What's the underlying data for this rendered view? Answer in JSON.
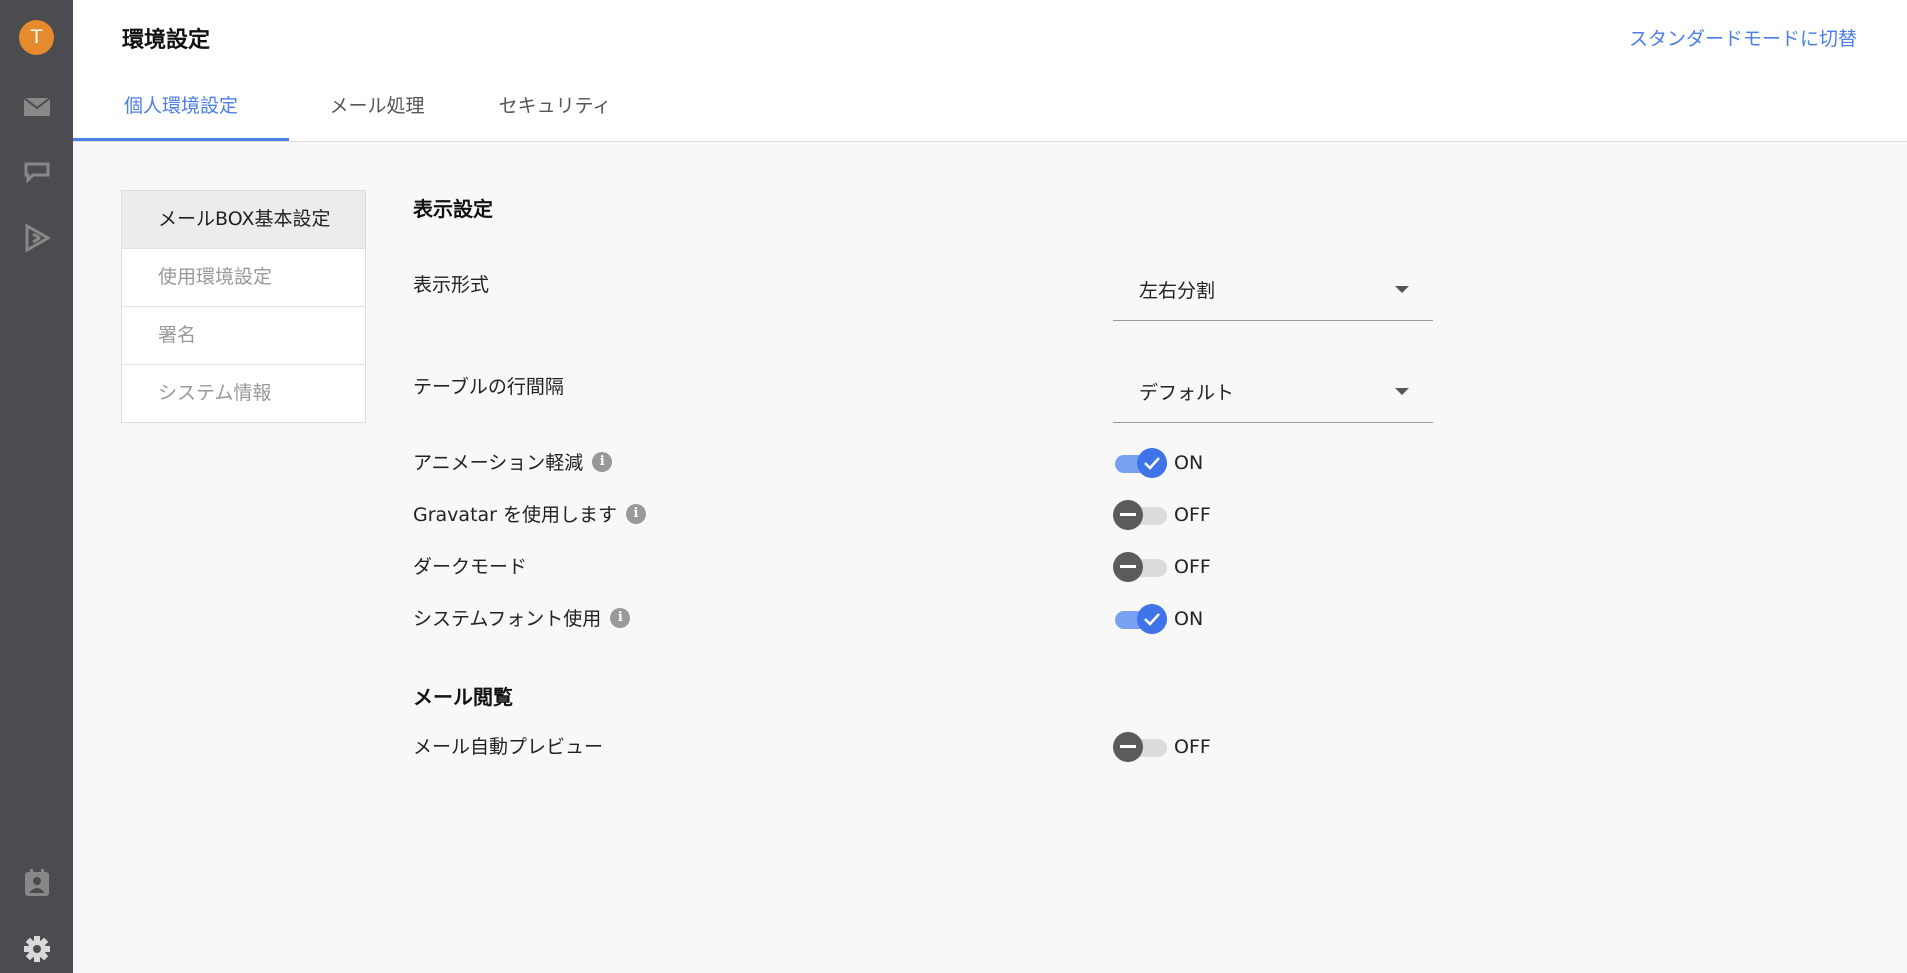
{
  "rail": {
    "avatar_letter": "T",
    "icons": [
      "mail-icon",
      "chat-icon",
      "send-icon",
      "contacts-icon",
      "gear-icon"
    ]
  },
  "header": {
    "title": "環境設定",
    "mode_link": "スタンダードモードに切替",
    "tabs": [
      {
        "label": "個人環境設定",
        "active": true
      },
      {
        "label": "メール処理",
        "active": false
      },
      {
        "label": "セキュリティ",
        "active": false
      }
    ],
    "accent_color": "#4a7fe8"
  },
  "subnav": {
    "items": [
      {
        "label": "メールBOX基本設定",
        "selected": true
      },
      {
        "label": "使用環境設定",
        "selected": false
      },
      {
        "label": "署名",
        "selected": false
      },
      {
        "label": "システム情報",
        "selected": false
      }
    ]
  },
  "display_settings": {
    "title": "表示設定",
    "display_format": {
      "label": "表示形式",
      "value": "左右分割"
    },
    "table_row_spacing": {
      "label": "テーブルの行間隔",
      "value": "デフォルト"
    },
    "reduce_animation": {
      "label": "アニメーション軽減",
      "state": "ON"
    },
    "use_gravatar": {
      "label": "Gravatar を使用します",
      "state": "OFF"
    },
    "dark_mode": {
      "label": "ダークモード",
      "state": "OFF"
    },
    "system_font": {
      "label": "システムフォント使用",
      "state": "ON"
    }
  },
  "mail_view": {
    "title": "メール閲覧",
    "auto_preview": {
      "label": "メール自動プレビュー",
      "state": "OFF"
    }
  }
}
